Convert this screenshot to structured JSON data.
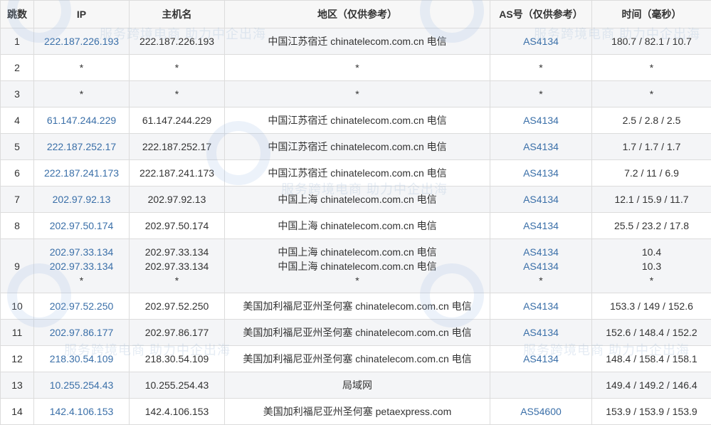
{
  "headers": {
    "hop": "跳数",
    "ip": "IP",
    "host": "主机名",
    "region": "地区（仅供参考）",
    "as": "AS号（仅供参考）",
    "time": "时间（毫秒）"
  },
  "watermark_text": "服务跨境电商 助力中企出海",
  "rows": [
    {
      "hop": "1",
      "ip": [
        "222.187.226.193"
      ],
      "host": [
        "222.187.226.193"
      ],
      "region": [
        "中国江苏宿迁 chinatelecom.com.cn 电信"
      ],
      "as": [
        "AS4134"
      ],
      "time": [
        "180.7 / 82.1 / 10.7"
      ]
    },
    {
      "hop": "2",
      "ip": [
        "*"
      ],
      "host": [
        "*"
      ],
      "region": [
        "*"
      ],
      "as": [
        "*"
      ],
      "time": [
        "*"
      ]
    },
    {
      "hop": "3",
      "ip": [
        "*"
      ],
      "host": [
        "*"
      ],
      "region": [
        "*"
      ],
      "as": [
        "*"
      ],
      "time": [
        "*"
      ]
    },
    {
      "hop": "4",
      "ip": [
        "61.147.244.229"
      ],
      "host": [
        "61.147.244.229"
      ],
      "region": [
        "中国江苏宿迁 chinatelecom.com.cn 电信"
      ],
      "as": [
        "AS4134"
      ],
      "time": [
        "2.5 / 2.8 / 2.5"
      ]
    },
    {
      "hop": "5",
      "ip": [
        "222.187.252.17"
      ],
      "host": [
        "222.187.252.17"
      ],
      "region": [
        "中国江苏宿迁 chinatelecom.com.cn 电信"
      ],
      "as": [
        "AS4134"
      ],
      "time": [
        "1.7 / 1.7 / 1.7"
      ]
    },
    {
      "hop": "6",
      "ip": [
        "222.187.241.173"
      ],
      "host": [
        "222.187.241.173"
      ],
      "region": [
        "中国江苏宿迁 chinatelecom.com.cn 电信"
      ],
      "as": [
        "AS4134"
      ],
      "time": [
        "7.2 / 11 / 6.9"
      ]
    },
    {
      "hop": "7",
      "ip": [
        "202.97.92.13"
      ],
      "host": [
        "202.97.92.13"
      ],
      "region": [
        "中国上海 chinatelecom.com.cn 电信"
      ],
      "as": [
        "AS4134"
      ],
      "time": [
        "12.1 / 15.9 / 11.7"
      ]
    },
    {
      "hop": "8",
      "ip": [
        "202.97.50.174"
      ],
      "host": [
        "202.97.50.174"
      ],
      "region": [
        "中国上海 chinatelecom.com.cn 电信"
      ],
      "as": [
        "AS4134"
      ],
      "time": [
        "25.5 / 23.2 / 17.8"
      ]
    },
    {
      "hop": "9",
      "ip": [
        "202.97.33.134",
        "202.97.33.134",
        "*"
      ],
      "host": [
        "202.97.33.134",
        "202.97.33.134",
        "*"
      ],
      "region": [
        "中国上海 chinatelecom.com.cn 电信",
        "中国上海 chinatelecom.com.cn 电信",
        "*"
      ],
      "as": [
        "AS4134",
        "AS4134",
        "*"
      ],
      "time": [
        "10.4",
        "10.3",
        "*"
      ]
    },
    {
      "hop": "10",
      "ip": [
        "202.97.52.250"
      ],
      "host": [
        "202.97.52.250"
      ],
      "region": [
        "美国加利福尼亚州圣何塞 chinatelecom.com.cn 电信"
      ],
      "as": [
        "AS4134"
      ],
      "time": [
        "153.3 / 149 / 152.6"
      ]
    },
    {
      "hop": "11",
      "ip": [
        "202.97.86.177"
      ],
      "host": [
        "202.97.86.177"
      ],
      "region": [
        "美国加利福尼亚州圣何塞 chinatelecom.com.cn 电信"
      ],
      "as": [
        "AS4134"
      ],
      "time": [
        "152.6 / 148.4 / 152.2"
      ]
    },
    {
      "hop": "12",
      "ip": [
        "218.30.54.109"
      ],
      "host": [
        "218.30.54.109"
      ],
      "region": [
        "美国加利福尼亚州圣何塞 chinatelecom.com.cn 电信"
      ],
      "as": [
        "AS4134"
      ],
      "time": [
        "148.4 / 158.4 / 158.1"
      ]
    },
    {
      "hop": "13",
      "ip": [
        "10.255.254.43"
      ],
      "host": [
        "10.255.254.43"
      ],
      "region": [
        "局域网"
      ],
      "as": [
        ""
      ],
      "time": [
        "149.4 / 149.2 / 146.4"
      ]
    },
    {
      "hop": "14",
      "ip": [
        "142.4.106.153"
      ],
      "host": [
        "142.4.106.153"
      ],
      "region": [
        "美国加利福尼亚州圣何塞 petaexpress.com"
      ],
      "as": [
        "AS54600"
      ],
      "time": [
        "153.9 / 153.9 / 153.9"
      ]
    }
  ]
}
